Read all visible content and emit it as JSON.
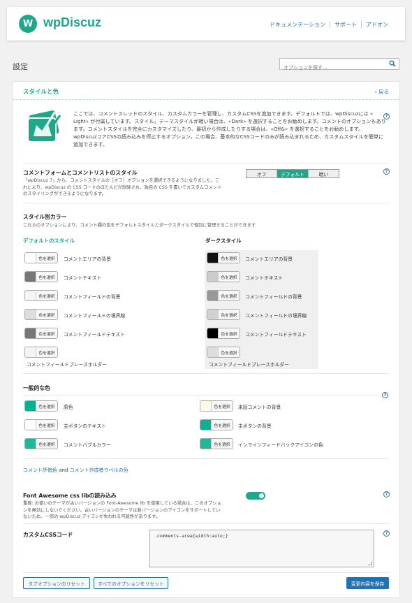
{
  "header": {
    "logo_letter": "W",
    "logo_text": "wpDiscuz",
    "nav": [
      "ドキュメンテーション",
      "サポート",
      "アドオン"
    ]
  },
  "page_title": "設定",
  "search": {
    "placeholder": "オプションを探す..."
  },
  "panel": {
    "title": "スタイルと色",
    "back": "戻る",
    "intro": "ここでは、コメントスレッドのスタイル、カスタムカラーを管理し、カスタムCSSを追加できます。デフォルトでは、wpDiscuzには « Light» が付属しています。スタイル。テーマスタイルが暗い場合は、«Dark» を選択することをお勧めします。コメントのオプションもあります。コメントスタイルを完全にカスタマイズしたり、最初から作成したりする場合は、«Off&» を選択することをお勧めします。 wpDiscuzコアCSSの読み込みを停止するオプション。この場合、基本的なCSSコードのみが読み込まれるため、カスタムスタイルを簡単に追加できます。"
  },
  "form_style": {
    "title": "コメントフォームとコメントリストのスタイル",
    "desc": "「wpDiscuz 7」から、コメントスタイルの［オフ］オプションを選択できるようになりました。これにより、wpDiscuz の CSS コードのほとんどが削除され、独自の CSS を書いてカスタムコメントのスタイリングができるようになります。",
    "options": [
      "オフ",
      "デフォルト",
      "暗い"
    ],
    "selected": "デフォルト"
  },
  "style_colors": {
    "title": "スタイル別カラー",
    "desc": "これらのオプションにより、コメント欄の色をデフォルトスタイルとダークスタイルで個別に管理することができます",
    "default_title": "デフォルトのスタイル",
    "dark_title": "ダークスタイル",
    "button_label": "色を選択",
    "default_items": [
      {
        "label": "コメントエリアの背景",
        "color": "#ffffff"
      },
      {
        "label": "コメントテキスト",
        "color": "#777777"
      },
      {
        "label": "コメントフィールドの背景",
        "color": "#f4f4f4"
      },
      {
        "label": "コメントフィールドの境界線",
        "color": "#dddddd"
      },
      {
        "label": "コメントフィールドテキスト",
        "color": "#777777"
      },
      {
        "label": "コメントフィールドプレースホルダー",
        "color": "#f4f4f4"
      }
    ],
    "dark_items": [
      {
        "label": "コメントエリアの背景",
        "color": "#111111"
      },
      {
        "label": "コメントテキスト",
        "color": "#cccccc"
      },
      {
        "label": "コメントフィールドの背景",
        "color": "#999999"
      },
      {
        "label": "コメントフィールドの境界線",
        "color": "#d1d1d1"
      },
      {
        "label": "コメントフィールドテキスト",
        "color": "#000000"
      },
      {
        "label": "コメントフィールドプレースホルダー",
        "color": "#dddddd"
      }
    ]
  },
  "general_colors": {
    "title": "一般的な色",
    "button_label": "色を選択",
    "left": [
      {
        "label": "原色",
        "color": "#00b38f"
      },
      {
        "label": "主ボタンのテキスト",
        "color": "#ffffff"
      },
      {
        "label": "コメントバブルカラー",
        "color": "#1db99a"
      }
    ],
    "right": [
      {
        "label": "未読コメントの背景",
        "color": "#fffae8"
      },
      {
        "label": "主ボタンの背景",
        "color": "#07b290"
      },
      {
        "label": "インラインフィードバックアイコンの色",
        "color": "#1db99a"
      }
    ]
  },
  "rating_links": {
    "a": "コメント評価色",
    "and": "and",
    "b": "コメント作成者ラベルの色"
  },
  "font_awesome": {
    "title": "Font Awesome css libの読み込み",
    "desc": "重要: お使いのテーマが古いバージョンの Font-Awesome lib を使用している場合は、このオプションを無効にしないでください。古いバージョンのテーマは新バージョンのアイコンをサポートしていないため、一部の wpDiscuz アイコンが失われる可能性があります。",
    "enabled": true
  },
  "custom_css": {
    "title": "カスタムCSSコード",
    "value": ".comments-area{width:auto;}"
  },
  "buttons": {
    "reset_tab": "タブオプションのリセット",
    "reset_all": "すべてのオプションをリセット",
    "save": "変更内容を保存"
  },
  "accent": "#1ea889",
  "link_color": "#2271b1"
}
